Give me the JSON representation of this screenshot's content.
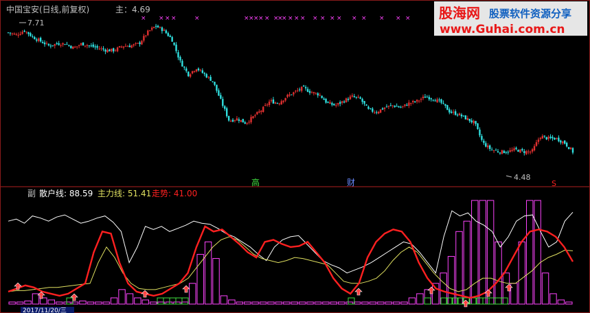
{
  "colors": {
    "background": "#000000",
    "frame": "#8a1a1a",
    "separator": "#b02020",
    "header_text": "#c0c0c0",
    "up_candle": "#e03030",
    "down_candle": "#30e0e0",
    "signal_mark": "#ff44ff",
    "retail_line": "#ffffff",
    "main_force_line": "#e0e060",
    "trend_line": "#ff2020",
    "histogram_bar": "#ff44ff",
    "signal_box": "#40e040",
    "arrow_up": "#ff4040",
    "watermark_red": "#e81818",
    "watermark_blue": "#1060c0",
    "date_box_bg": "#0a1a6a",
    "date_box_text": "#ffffff"
  },
  "main_panel": {
    "title": "中国宝安(日线,前复权)",
    "indicator_label": "主：4.69",
    "high_annotation": "7.71",
    "low_annotation": "4.48",
    "tag_high": "高",
    "tag_finance": "财",
    "tag_s": "S",
    "signal_marks": "×"
  },
  "sub_panel": {
    "prefix": "副",
    "retail_label": "散户线: 88.59",
    "main_force_label": "主力线: 51.41",
    "trend_label": "走势: 41.00"
  },
  "axis": {
    "date_label": "2017/11/20/三"
  },
  "watermark": {
    "brand": "股海网",
    "slogan": "股票软件资源分享",
    "url": "www.Guhai.com.cn"
  },
  "chart_data": [
    {
      "type": "candlestick",
      "name": "中国宝安(日线,前复权)",
      "annotations": [
        {
          "label": "7.71",
          "kind": "high"
        },
        {
          "label": "4.48",
          "kind": "low"
        }
      ],
      "close_path": [
        7.55,
        7.5,
        7.6,
        7.45,
        7.35,
        7.25,
        7.3,
        7.3,
        7.2,
        7.3,
        7.25,
        7.2,
        7.15,
        7.15,
        7.25,
        7.25,
        7.3,
        7.55,
        7.7,
        7.6,
        7.4,
        6.9,
        6.6,
        6.75,
        6.6,
        6.45,
        6.0,
        5.55,
        5.6,
        5.5,
        5.65,
        5.8,
        6.0,
        5.95,
        6.1,
        6.2,
        6.3,
        6.2,
        6.15,
        5.95,
        5.9,
        6.0,
        6.1,
        6.05,
        5.8,
        5.75,
        5.85,
        5.9,
        5.85,
        5.95,
        6.0,
        6.1,
        6.05,
        5.95,
        5.75,
        5.7,
        5.6,
        5.5,
        5.05,
        4.9,
        4.85,
        4.85,
        4.9,
        4.85,
        4.85,
        5.2,
        5.15,
        5.15,
        5.05,
        4.85
      ]
    },
    {
      "type": "line",
      "name": "副图",
      "series": [
        {
          "name": "散户线",
          "last_value": 88.59,
          "values": [
            80,
            82,
            78,
            85,
            83,
            80,
            84,
            86,
            82,
            78,
            80,
            83,
            85,
            79,
            70,
            40,
            55,
            75,
            72,
            75,
            70,
            73,
            76,
            80,
            78,
            77,
            73,
            68,
            65,
            60,
            55,
            48,
            42,
            55,
            62,
            65,
            66,
            58,
            50,
            42,
            38,
            35,
            30,
            33,
            36,
            40,
            45,
            50,
            55,
            60,
            58,
            50,
            40,
            30,
            65,
            90,
            85,
            88,
            80,
            76,
            70,
            55,
            65,
            80,
            85,
            86,
            70,
            55,
            60,
            80,
            88.59
          ]
        },
        {
          "name": "主力线",
          "last_value": 51.41,
          "values": [
            12,
            13,
            13,
            14,
            15,
            16,
            16,
            17,
            18,
            19,
            20,
            40,
            55,
            45,
            30,
            20,
            15,
            14,
            14,
            16,
            18,
            20,
            25,
            35,
            45,
            55,
            62,
            65,
            62,
            55,
            48,
            44,
            42,
            40,
            42,
            45,
            44,
            42,
            40,
            38,
            30,
            22,
            20,
            20,
            22,
            25,
            32,
            42,
            50,
            55,
            50,
            40,
            30,
            22,
            15,
            12,
            14,
            20,
            25,
            25,
            22,
            20,
            20,
            26,
            32,
            40,
            45,
            48,
            52,
            51.41
          ]
        },
        {
          "name": "走势",
          "last_value": 41.0,
          "values": [
            12,
            15,
            18,
            16,
            12,
            10,
            8,
            10,
            15,
            20,
            50,
            70,
            68,
            40,
            20,
            12,
            10,
            8,
            10,
            15,
            20,
            30,
            55,
            75,
            70,
            72,
            65,
            58,
            50,
            45,
            60,
            62,
            58,
            55,
            56,
            60,
            50,
            40,
            25,
            15,
            10,
            20,
            45,
            60,
            68,
            72,
            70,
            60,
            40,
            25,
            15,
            12,
            10,
            8,
            6,
            8,
            12,
            20,
            30,
            45,
            60,
            70,
            72,
            70,
            65,
            55,
            41
          ]
        }
      ]
    },
    {
      "type": "bar",
      "name": "柱状",
      "values": [
        2,
        2,
        3,
        10,
        6,
        4,
        2,
        2,
        2,
        3,
        2,
        2,
        2,
        6,
        14,
        10,
        6,
        4,
        2,
        2,
        2,
        2,
        2,
        20,
        48,
        60,
        44,
        8,
        4,
        2,
        2,
        2,
        2,
        2,
        2,
        2,
        2,
        2,
        2,
        2,
        2,
        2,
        2,
        2,
        2,
        2,
        2,
        2,
        2,
        2,
        2,
        6,
        10,
        14,
        20,
        30,
        46,
        70,
        80,
        100,
        100,
        100,
        60,
        30,
        20,
        60,
        100,
        100,
        30,
        10,
        4,
        2
      ]
    }
  ]
}
